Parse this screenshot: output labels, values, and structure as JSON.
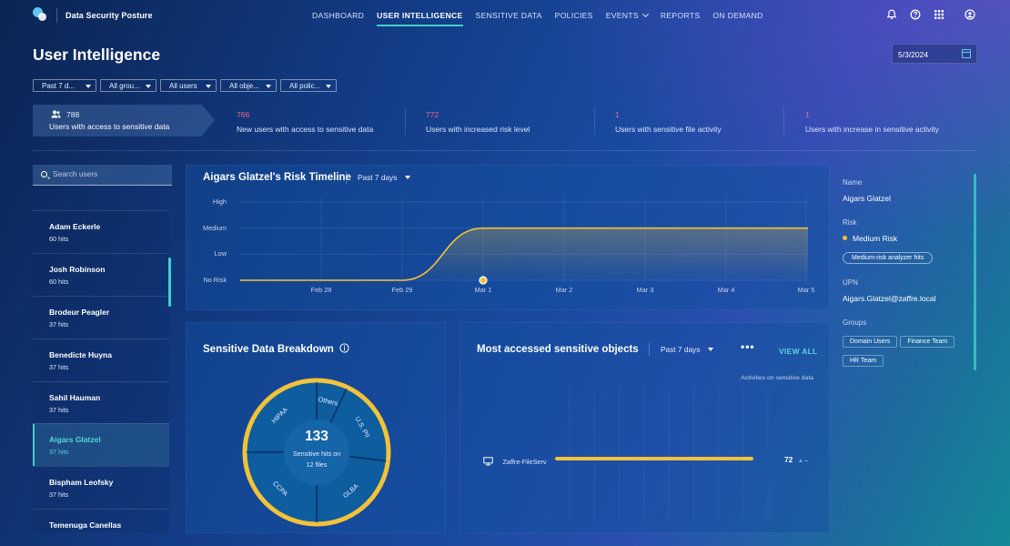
{
  "app": {
    "title": "Data Security Posture"
  },
  "nav": {
    "items": [
      {
        "label": "DASHBOARD"
      },
      {
        "label": "USER INTELLIGENCE",
        "active": true
      },
      {
        "label": "SENSITIVE DATA"
      },
      {
        "label": "POLICIES"
      },
      {
        "label": "EVENTS"
      },
      {
        "label": "REPORTS"
      },
      {
        "label": "ON DEMAND"
      }
    ],
    "icons": [
      "bell-icon",
      "help-icon",
      "apps-grid-icon",
      "user-account-icon"
    ]
  },
  "page": {
    "title": "User Intelligence",
    "date": "5/3/2024"
  },
  "filters": [
    "Past 7 d...",
    "All grou...",
    "All users",
    "All obje...",
    "All polic..."
  ],
  "stats": [
    {
      "value": "788",
      "label": "Users with access to sensitive data"
    },
    {
      "value": "766",
      "label": "New users with access to sensitive data"
    },
    {
      "value": "772",
      "label": "Users with increased risk level"
    },
    {
      "value": "1",
      "label": "Users with sensitive file activity"
    },
    {
      "value": "1",
      "label": "Users with increase in sensitive activity"
    }
  ],
  "search": {
    "placeholder": "Search users"
  },
  "users": [
    {
      "name": "Adam Eckerle",
      "hits": "60 hits"
    },
    {
      "name": "Josh Robinson",
      "hits": "60 hits"
    },
    {
      "name": "Brodeur Peagler",
      "hits": "37 hits"
    },
    {
      "name": "Benedicte Huyna",
      "hits": "37 hits"
    },
    {
      "name": "Sahil Hauman",
      "hits": "37 hits"
    },
    {
      "name": "Aigars Glatzel",
      "hits": "37 hits",
      "selected": true
    },
    {
      "name": "Bispham Leofsky",
      "hits": "37 hits"
    },
    {
      "name": "Temenuga Canellas",
      "hits": ""
    }
  ],
  "timeline": {
    "title": "Aigars Glatzel's Risk Timeline",
    "range": "Past 7 days",
    "chart_data": {
      "type": "line",
      "y_levels": [
        "No Risk",
        "Low",
        "Medium",
        "High"
      ],
      "x": [
        "Feb 28",
        "Feb 29",
        "Mar 1",
        "Mar 2",
        "Mar 3",
        "Mar 4",
        "Mar 5"
      ],
      "series": [
        {
          "values": [
            "No Risk",
            "No Risk",
            "Medium",
            "Medium",
            "Medium",
            "Medium",
            "Medium"
          ]
        }
      ],
      "marker": "Mar 1",
      "colors": {
        "line": "#f3c23a"
      }
    }
  },
  "breakdown": {
    "title": "Sensitive Data Breakdown",
    "center_value": "133",
    "center_line1": "Sensitive hits on",
    "center_line2": "12 files",
    "chart_data": {
      "type": "pie",
      "slices": [
        {
          "label": "Others",
          "value": 7
        },
        {
          "label": "U.S. PII",
          "value": 20
        },
        {
          "label": "GLBA",
          "value": 23
        },
        {
          "label": "CCPA",
          "value": 25
        },
        {
          "label": "HIPAA",
          "value": 25
        }
      ],
      "colors": {
        "ring": "#f3c23a"
      }
    }
  },
  "objects": {
    "title": "Most accessed sensitive objects",
    "range": "Past 7 days",
    "more": "•••",
    "view_all": "VIEW ALL",
    "axis_label": "Activities on sensitive data",
    "chart_data": {
      "type": "bar",
      "categories": [
        "Zaffre-FileServ"
      ],
      "values": [
        72
      ],
      "trend": "–",
      "colors": {
        "bar": "#f3c23a"
      }
    }
  },
  "details": {
    "name_label": "Name",
    "name": "Aigars Glatzel",
    "risk_label": "Risk",
    "risk": "Medium Risk",
    "risk_reason": "Medium-risk analyzer hits",
    "upn_label": "UPN",
    "upn": "Aigars.Glatzel@zaffre.local",
    "groups_label": "Groups",
    "groups": [
      "Domain Users",
      "Finance Team",
      "HR Team"
    ]
  }
}
